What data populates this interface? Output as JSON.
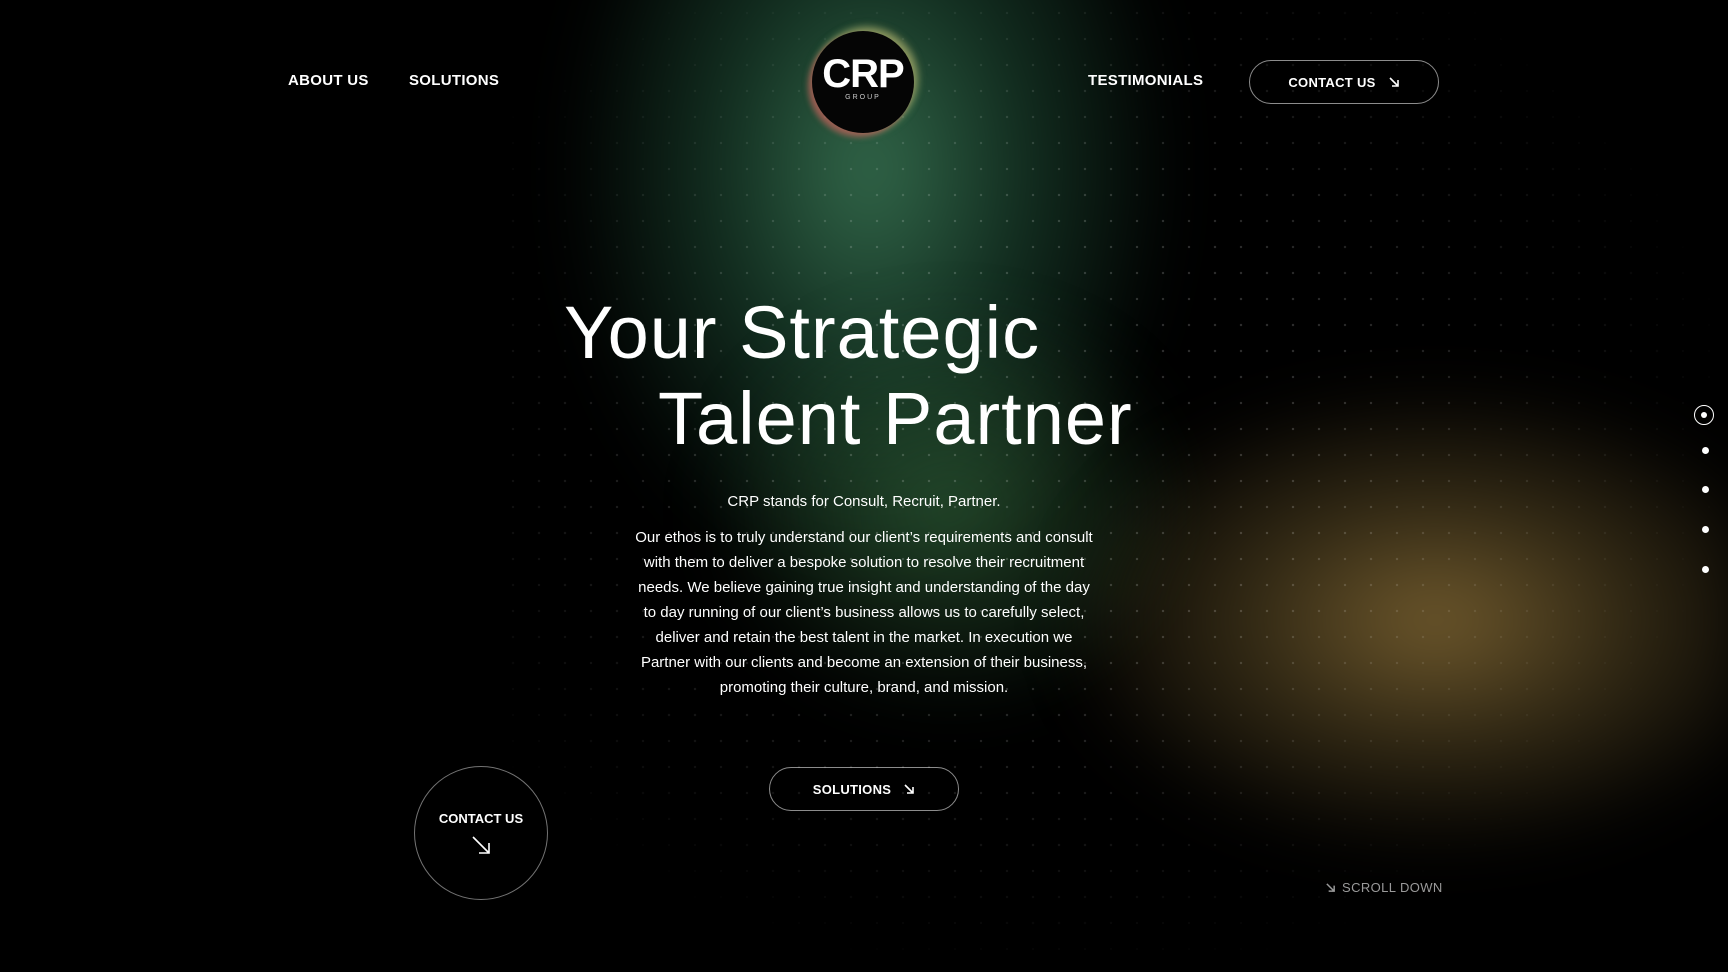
{
  "nav": {
    "about": "ABOUT US",
    "solutions": "SOLUTIONS",
    "testimonials": "TESTIMONIALS",
    "contact_button": "CONTACT US"
  },
  "logo": {
    "main": "CRP",
    "sub": "GROUP"
  },
  "hero": {
    "title_line1": "Your Strategic",
    "title_line2": "Talent Partner",
    "tagline": "CRP stands for Consult, Recruit, Partner.",
    "description": "Our ethos is to truly understand our client’s requirements and consult with them to deliver a bespoke solution to resolve their recruitment needs. We believe gaining true insight and understanding of the day to day running of our client’s business allows us to carefully select, deliver and retain the best talent in the market. In execution we Partner with our clients and become an extension of their business, promoting their culture, brand, and mission.",
    "solutions_button": "SOLUTIONS"
  },
  "floating_contact": {
    "label": "CONTACT US"
  },
  "scroll": {
    "label": "SCROLL DOWN"
  },
  "pager": {
    "total": 5,
    "active": 1
  },
  "colors": {
    "background": "#000000",
    "glow_green": "#448c64",
    "glow_gold": "#96783c",
    "text": "#ffffff",
    "muted": "#9a9a9a"
  },
  "icons": {
    "arrow": "arrow-down-right-icon"
  }
}
